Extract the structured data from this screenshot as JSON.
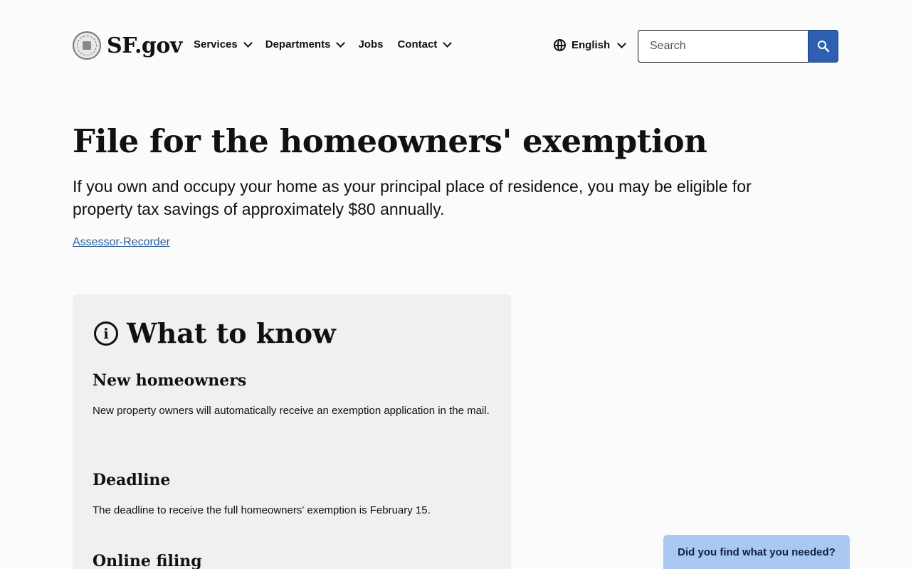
{
  "header": {
    "logo_text": "SF.gov",
    "nav": [
      {
        "label": "Services",
        "has_menu": true
      },
      {
        "label": "Departments",
        "has_menu": true
      },
      {
        "label": "Jobs",
        "has_menu": false
      },
      {
        "label": "Contact",
        "has_menu": true
      }
    ],
    "language": "English",
    "search_placeholder": "Search"
  },
  "page": {
    "title": "File for the homeowners' exemption",
    "intro": "If you own and occupy your home as your principal place of residence, you may be eligible for property tax savings of approximately $80 annually.",
    "department_link": "Assessor-Recorder"
  },
  "what_to_know": {
    "heading": "What to know",
    "sections": [
      {
        "title": "New homeowners",
        "body": "New property owners will automatically receive an exemption application in the mail."
      },
      {
        "title": "Deadline",
        "body": "The deadline to receive the full homeowners' exemption is February 15."
      },
      {
        "title": "Online filing",
        "body": ""
      }
    ]
  },
  "feedback": {
    "label": "Did you find what you needed?"
  },
  "colors": {
    "accent": "#2f5fb3",
    "link": "#2d5f99",
    "feedback_bg": "#a9c8f2",
    "card_bg": "#eff0ef"
  }
}
